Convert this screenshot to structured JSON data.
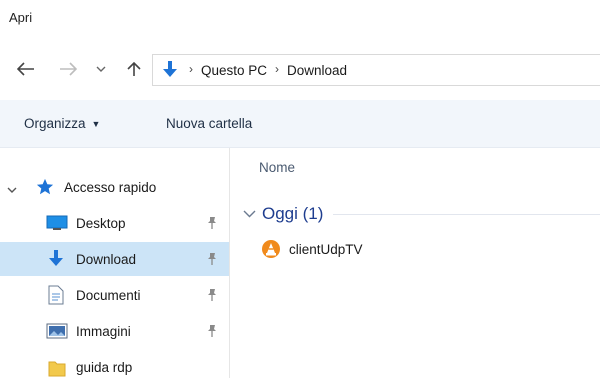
{
  "window": {
    "title": "Apri"
  },
  "nav": {
    "breadcrumbs": [
      "Questo PC",
      "Download"
    ],
    "separator": "›"
  },
  "toolbar": {
    "organize_label": "Organizza",
    "new_folder_label": "Nuova cartella"
  },
  "sidebar": {
    "quick_access_label": "Accesso rapido",
    "items": [
      {
        "label": "Desktop",
        "icon": "desktop-icon",
        "pinned": true
      },
      {
        "label": "Download",
        "icon": "download-icon",
        "pinned": true,
        "selected": true
      },
      {
        "label": "Documenti",
        "icon": "document-icon",
        "pinned": true
      },
      {
        "label": "Immagini",
        "icon": "images-icon",
        "pinned": true
      },
      {
        "label": "guida rdp",
        "icon": "folder-icon",
        "pinned": false
      }
    ]
  },
  "content": {
    "column_name": "Nome",
    "group_title": "Oggi (1)",
    "files": [
      {
        "name": "clientUdpTV",
        "icon": "vlc-cone-icon"
      }
    ]
  },
  "colors": {
    "accent_blue": "#1e73d6",
    "selection_bg": "#cce4f7",
    "toolbar_bg": "#f2f6fb",
    "group_title": "#1e3d8f",
    "star": "#1e73d6",
    "folder": "#f2c94c",
    "vlc_orange": "#f08a1c"
  }
}
